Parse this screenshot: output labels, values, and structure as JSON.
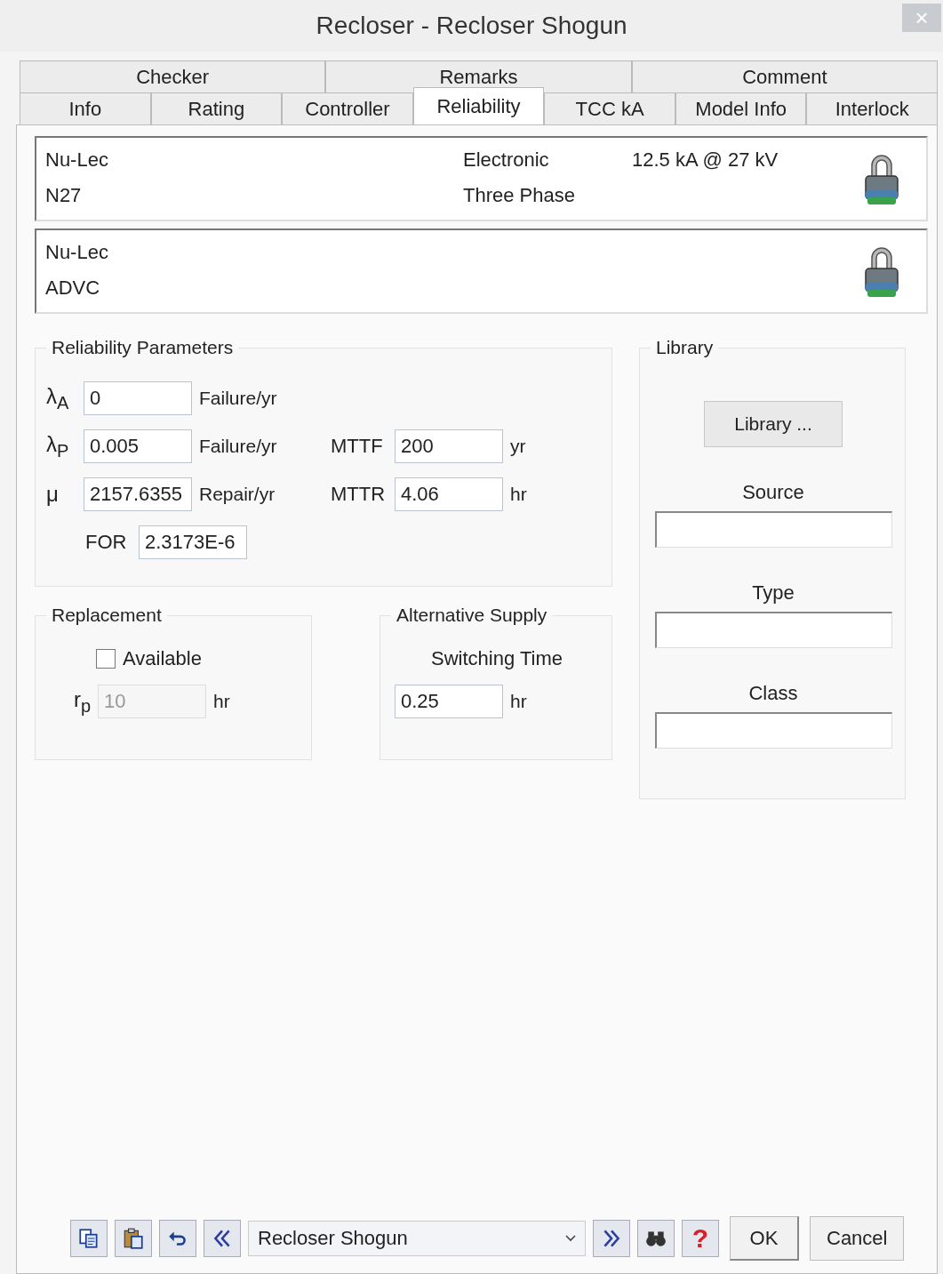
{
  "window": {
    "title": "Recloser - Recloser Shogun",
    "close": "×"
  },
  "tab_rows": [
    [
      {
        "label": "Checker",
        "selected": false
      },
      {
        "label": "Remarks",
        "selected": false
      },
      {
        "label": "Comment",
        "selected": false
      }
    ],
    [
      {
        "label": "Info",
        "selected": false
      },
      {
        "label": "Rating",
        "selected": false
      },
      {
        "label": "Controller",
        "selected": false
      },
      {
        "label": "Reliability",
        "selected": true
      },
      {
        "label": "TCC kA",
        "selected": false
      },
      {
        "label": "Model Info",
        "selected": false
      },
      {
        "label": "Interlock",
        "selected": false
      }
    ]
  ],
  "device_panels": [
    {
      "lines": [
        "Nu-Lec",
        "N27"
      ],
      "details": [
        "Electronic",
        "Three Phase"
      ],
      "rating": "12.5 kA @ 27 kV",
      "locked": true
    },
    {
      "lines": [
        "Nu-Lec",
        "ADVC"
      ],
      "locked": true
    }
  ],
  "reliability": {
    "title": "Reliability Parameters",
    "rows": [
      {
        "symbol": "λ$_{A}$",
        "value": "0",
        "unit": "Failure/yr"
      },
      {
        "symbol": "λ$_{P}$",
        "value": "0.005",
        "unit": "Failure/yr",
        "extra": {
          "label": "MTTF",
          "value": "200",
          "unit": "yr"
        }
      },
      {
        "symbol": "μ",
        "value": "2157.6355",
        "unit": "Repair/yr",
        "extra": {
          "label": "MTTR",
          "value": "4.06",
          "unit": "hr"
        }
      }
    ],
    "for": {
      "label": "FOR",
      "value": "2.3173E-6"
    }
  },
  "replacement": {
    "title": "Replacement",
    "available": {
      "label": "Available",
      "checked": false
    },
    "symbol": "r$_{p}$",
    "value": "10",
    "unit": "hr",
    "disabled": true
  },
  "alternative_supply": {
    "title": "Alternative Supply",
    "label": "Switching Time",
    "value": "0.25",
    "unit": "hr"
  },
  "library": {
    "title": "Library",
    "button": "Library ...",
    "fields": [
      {
        "label": "Source"
      },
      {
        "label": "Type"
      },
      {
        "label": "Class"
      }
    ]
  },
  "footer": {
    "selector": "Recloser Shogun",
    "ok": "OK",
    "cancel": "Cancel",
    "help": "?"
  }
}
